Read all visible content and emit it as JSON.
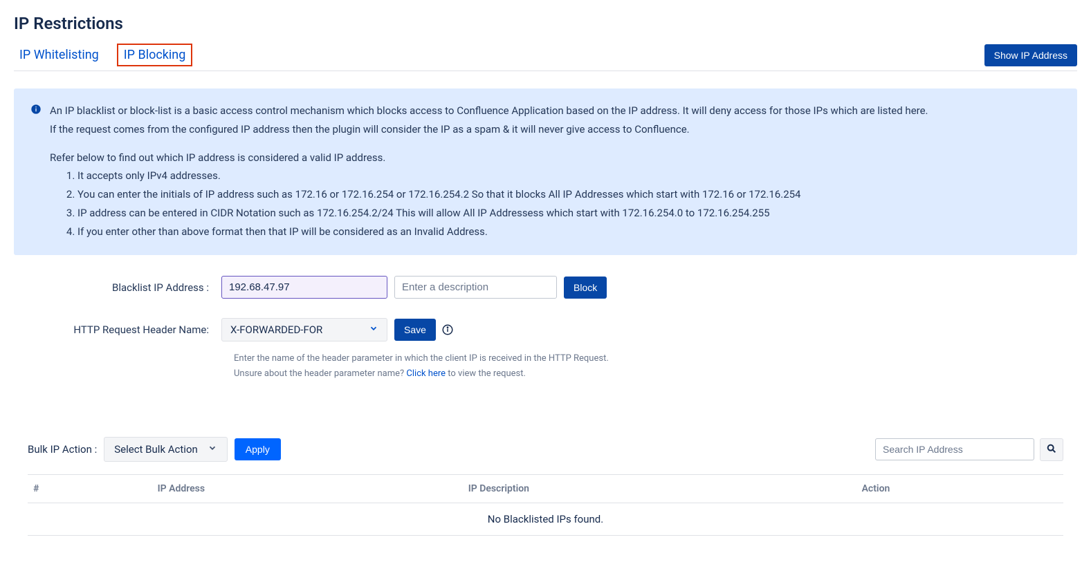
{
  "page": {
    "title": "IP Restrictions"
  },
  "tabs": {
    "whitelisting": "IP Whitelisting",
    "blocking": "IP Blocking"
  },
  "header_button": "Show IP Address",
  "info": {
    "p1": "An IP blacklist or block-list is a basic access control mechanism which blocks access to Confluence Application based on the IP address. It will deny access for those IPs which are listed here.",
    "p2": "If the request comes from the configured IP address then the plugin will consider the IP as a spam & it will never give access to Confluence.",
    "p3": "Refer below to find out which IP address is considered a valid IP address.",
    "li1": "It accepts only IPv4 addresses.",
    "li2": "You can enter the initials of IP address such as 172.16 or 172.16.254 or 172.16.254.2 So that it blocks All IP Addresses which start with 172.16 or 172.16.254",
    "li3": "IP address can be entered in CIDR Notation such as 172.16.254.2/24 This will allow All IP Addressess which start with 172.16.254.0 to 172.16.254.255",
    "li4": "If you enter other than above format then that IP will be considered as an Invalid Address."
  },
  "form": {
    "ip_label": "Blacklist IP Address :",
    "ip_value": "192.68.47.97",
    "desc_placeholder": "Enter a description",
    "block_btn": "Block",
    "header_label": "HTTP Request Header Name:",
    "header_value": "X-FORWARDED-FOR",
    "save_btn": "Save",
    "helper1": "Enter the name of the header parameter in which the client IP is received in the HTTP Request.",
    "helper2a": "Unsure about the header parameter name? ",
    "helper2link": "Click here",
    "helper2b": " to view the request."
  },
  "bulk": {
    "label": "Bulk IP Action :",
    "select_text": "Select Bulk Action",
    "apply": "Apply",
    "search_placeholder": "Search IP Address"
  },
  "table": {
    "col_num": "#",
    "col_ip": "IP Address",
    "col_desc": "IP Description",
    "col_action": "Action",
    "empty": "No Blacklisted IPs found."
  }
}
